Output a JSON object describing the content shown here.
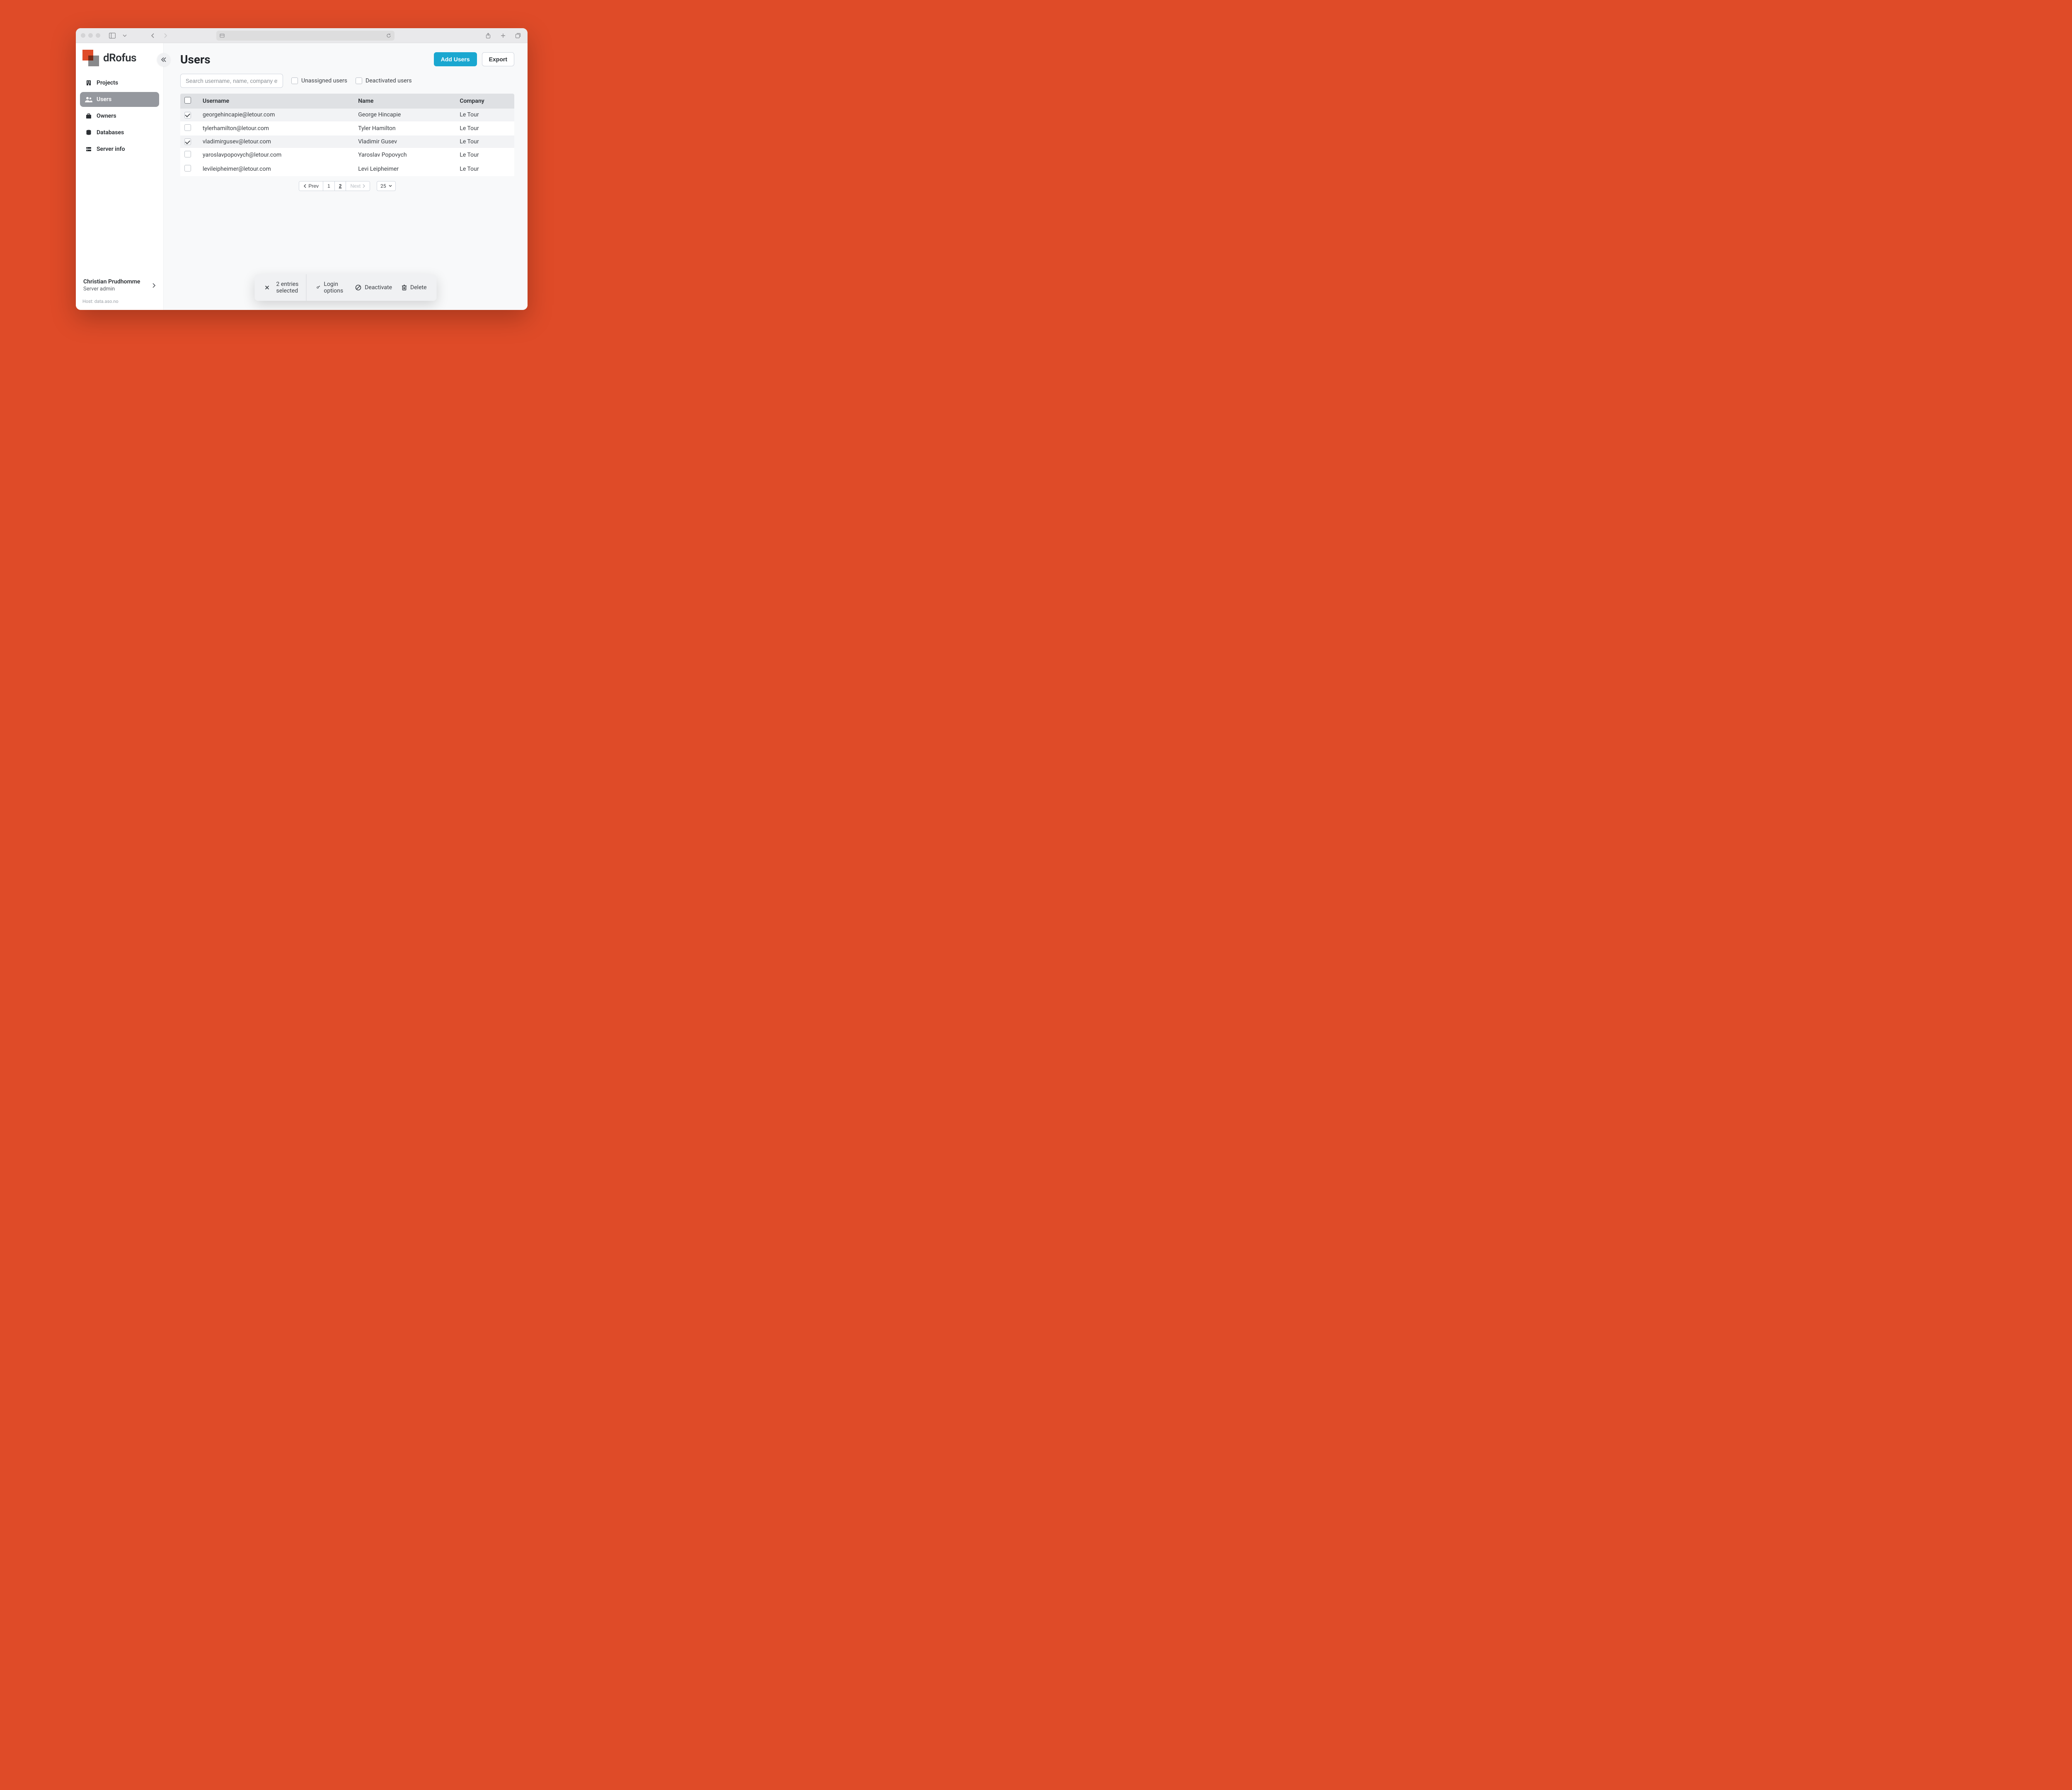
{
  "brand": {
    "name": "dRofus"
  },
  "sidebar": {
    "items": [
      {
        "label": "Projects"
      },
      {
        "label": "Users"
      },
      {
        "label": "Owners"
      },
      {
        "label": "Databases"
      },
      {
        "label": "Server info"
      }
    ]
  },
  "profile": {
    "name": "Christian Prudhomme",
    "role": "Server admin",
    "host_label": "Host: data.aso.no"
  },
  "header": {
    "title": "Users",
    "add_label": "Add Users",
    "export_label": "Export"
  },
  "filters": {
    "search_placeholder": "Search username, name, company etc.",
    "unassigned_label": "Unassigned users",
    "deactivated_label": "Deactivated users"
  },
  "table": {
    "columns": {
      "username": "Username",
      "name": "Name",
      "company": "Company"
    },
    "rows": [
      {
        "checked": true,
        "username": "georgehincapie@letour.com",
        "name": "George Hincapie",
        "company": "Le Tour"
      },
      {
        "checked": false,
        "username": "tylerhamilton@letour.com",
        "name": "Tyler Hamilton",
        "company": "Le Tour"
      },
      {
        "checked": true,
        "username": "vladimirgusev@letour.com",
        "name": "Vladimir Gusev",
        "company": "Le Tour"
      },
      {
        "checked": false,
        "username": "yaroslavpopovych@letour.com",
        "name": "Yaroslav Popovych",
        "company": "Le Tour"
      },
      {
        "checked": false,
        "username": "levileipheimer@letour.com",
        "name": "Levi Leipheimer",
        "company": "Le Tour"
      }
    ]
  },
  "pagination": {
    "prev_label": "Prev",
    "next_label": "Next",
    "page1": "1",
    "page2": "2",
    "page_size": "25"
  },
  "actionbar": {
    "selected_label": "2 entries selected",
    "login_options_label": "Login options",
    "deactivate_label": "Deactivate",
    "delete_label": "Delete"
  }
}
